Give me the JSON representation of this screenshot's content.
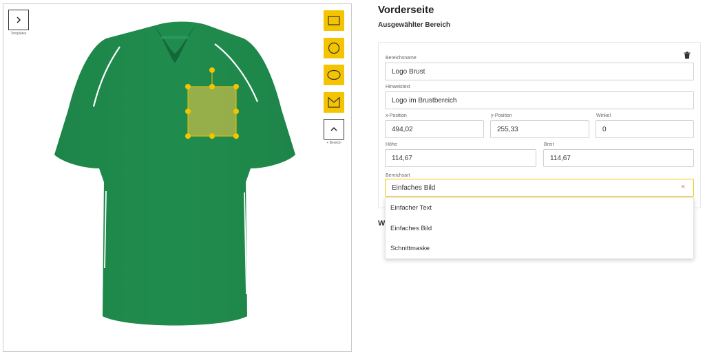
{
  "canvas": {
    "templates_label": "Templates",
    "add_area_label": "+ Bereich",
    "shirt_color": "#1f8a4c",
    "selection_color": "#b4b84a",
    "handle_color": "#f5c400"
  },
  "tools": [
    "rectangle-icon",
    "circle-icon",
    "ellipse-icon",
    "mask-icon"
  ],
  "panel": {
    "title": "Vorderseite",
    "subtitle": "Ausgewählter Bereich",
    "obscured_heading_letter": "W"
  },
  "form": {
    "name": {
      "label": "Bereichsname",
      "value": "Logo Brust"
    },
    "hint": {
      "label": "Hinweistext",
      "value": "Logo im Brustbereich"
    },
    "x": {
      "label": "x-Position",
      "value": "494,02"
    },
    "y": {
      "label": "y-Position",
      "value": "255,33"
    },
    "angle": {
      "label": "Winkel",
      "value": "0"
    },
    "height": {
      "label": "Höhe",
      "value": "114,67"
    },
    "width": {
      "label": "Breit",
      "value": "114,67"
    },
    "type": {
      "label": "Bereichsart",
      "value": "Einfaches Bild",
      "clear": "×"
    }
  },
  "dropdown": {
    "options": [
      "Einfacher Text",
      "Einfaches Bild",
      "Schnittmaske"
    ]
  },
  "accent": "#f5c400"
}
